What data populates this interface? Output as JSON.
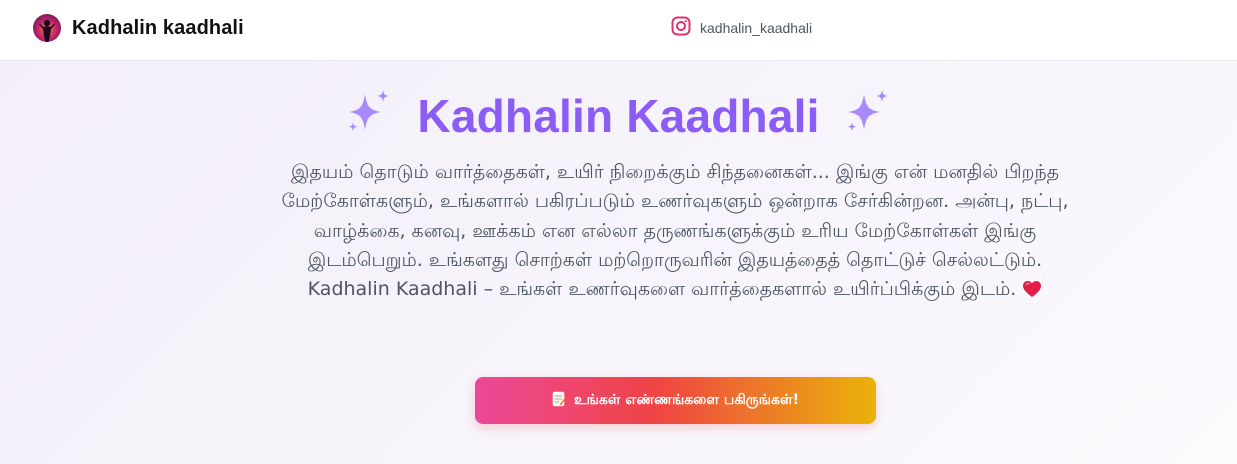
{
  "header": {
    "brand_name": "Kadhalin kaadhali",
    "logo_icon": "silhouette-sunset-avatar",
    "instagram_icon": "instagram-icon",
    "instagram_handle": "kadhalin_kaadhali"
  },
  "hero": {
    "title": "Kadhalin Kaadhali",
    "sparkle_icon": "sparkles-icon",
    "description": "இதயம் தொடும் வார்த்தைகள், உயிர் நிறைக்கும் சிந்தனைகள்... இங்கு என் மனதில் பிறந்த மேற்கோள்களும், உங்களால் பகிரப்படும் உணர்வுகளும் ஒன்றாக சேர்கின்றன. அன்பு, நட்பு, வாழ்க்கை, கனவு, ஊக்கம் என எல்லா தருணங்களுக்கும் உரிய மேற்கோள்கள் இங்கு இடம்பெறும். உங்களது சொற்கள் மற்றொருவரின் இதயத்தைத் தொட்டுச் செல்லட்டும். Kadhalin Kaadhali – உங்கள் உணர்வுகளை வார்த்தைகளால் உயிர்ப்பிக்கும் இடம்.",
    "heart_icon": "heart-icon"
  },
  "cta": {
    "icon": "memo-icon",
    "label": "உங்கள் எண்ணங்களை பகிருங்கள்!"
  },
  "colors": {
    "accent": "#8b5cf6",
    "text_muted": "#4b5563",
    "cta_gradient": [
      "#ec4899",
      "#ef4444",
      "#eab308"
    ],
    "instagram": "#e1306c"
  }
}
